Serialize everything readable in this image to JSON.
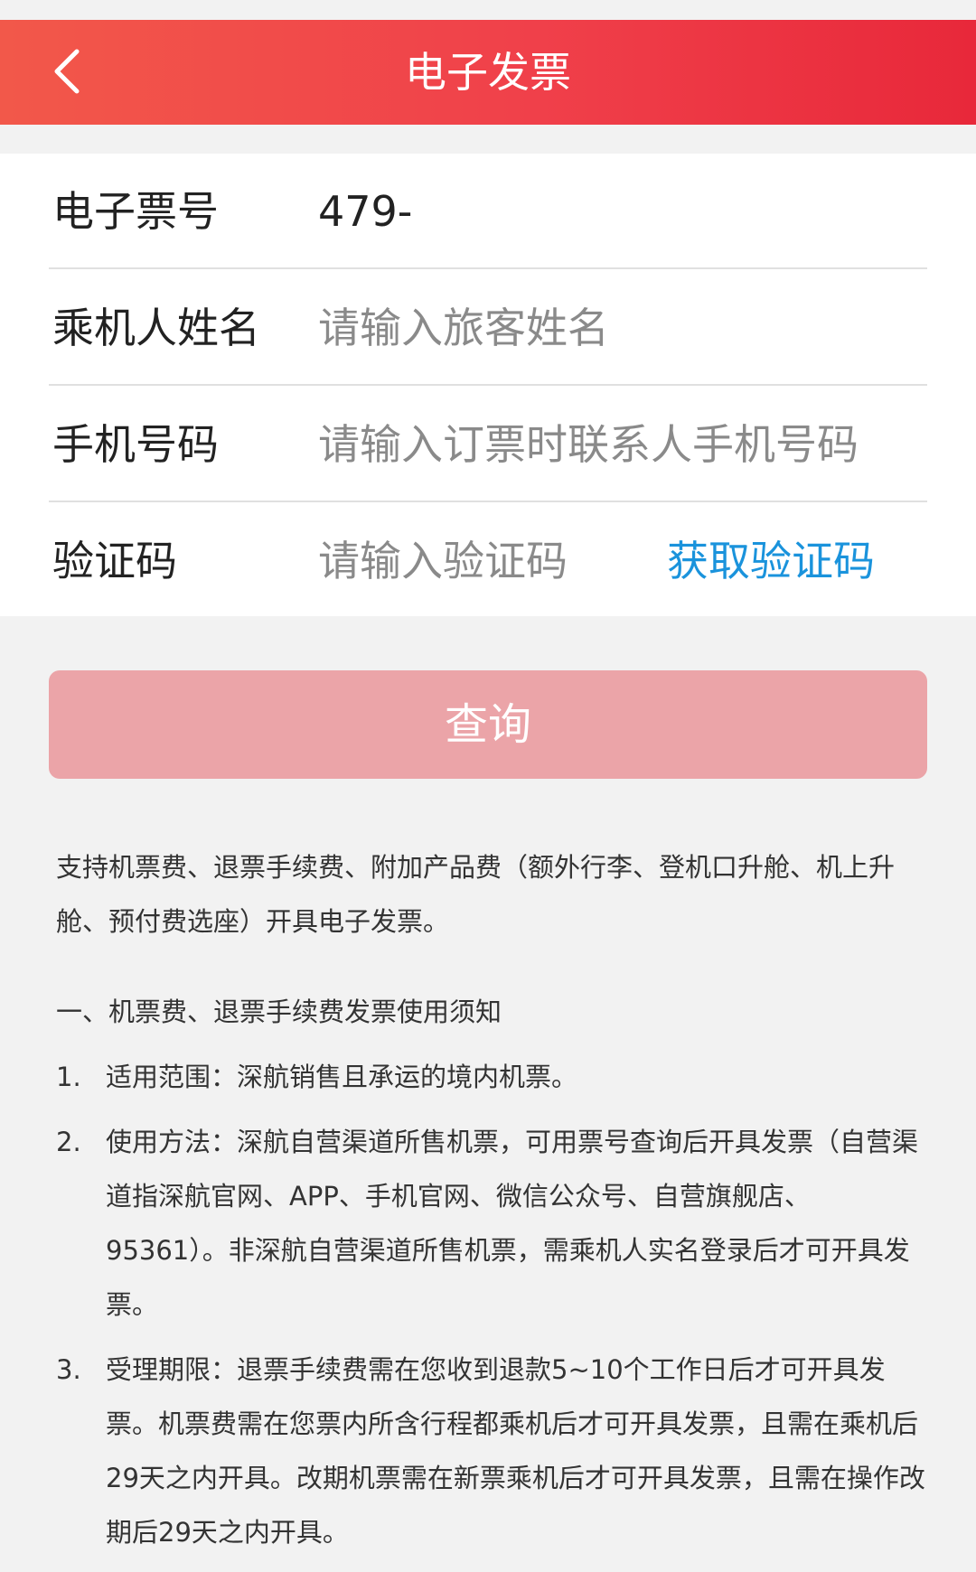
{
  "header": {
    "title": "电子发票",
    "back_icon": "chevron-left-icon"
  },
  "form": {
    "ticket_no": {
      "label": "电子票号",
      "value": "479-"
    },
    "passenger_name": {
      "label": "乘机人姓名",
      "placeholder": "请输入旅客姓名"
    },
    "phone": {
      "label": "手机号码",
      "placeholder": "请输入订票时联系人手机号码"
    },
    "verify_code": {
      "label": "验证码",
      "placeholder": "请输入验证码",
      "get_code_label": "获取验证码"
    }
  },
  "query_button": {
    "label": "查询"
  },
  "notice": {
    "intro": "支持机票费、退票手续费、附加产品费（额外行李、登机口升舱、机上升舱、预付费选座）开具电子发票。",
    "section_title": "一、机票费、退票手续费发票使用须知",
    "items": [
      {
        "num": "1.",
        "text": "适用范围：深航销售且承运的境内机票。"
      },
      {
        "num": "2.",
        "text": "使用方法：深航自营渠道所售机票，可用票号查询后开具发票（自营渠道指深航官网、APP、手机官网、微信公众号、自营旗舰店、95361）。非深航自营渠道所售机票，需乘机人实名登录后才可开具发票。"
      },
      {
        "num": "3.",
        "text": "受理期限：退票手续费需在您收到退款5~10个工作日后才可开具发票。机票费需在您票内所含行程都乘机后才可开具发票，且需在乘机后29天之内开具。改期机票需在新票乘机后才可开具发票，且需在操作改期后29天之内开具。"
      }
    ]
  },
  "colors": {
    "header_start": "#f2584a",
    "header_end": "#e8283a",
    "link_blue": "#1a93dc",
    "button_disabled": "#eba4a8"
  }
}
